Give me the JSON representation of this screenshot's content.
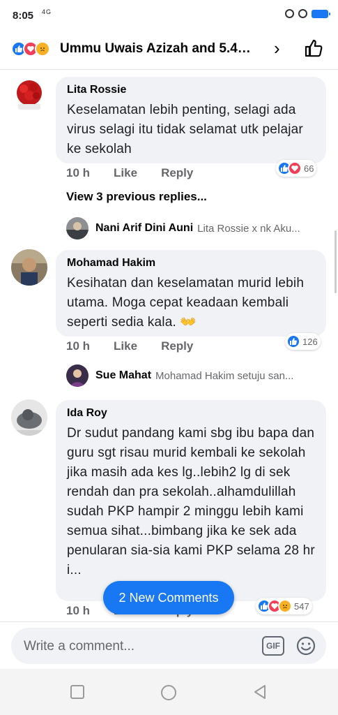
{
  "status": {
    "time": "8:05",
    "network": "4G"
  },
  "header": {
    "title": "Ummu Uwais Azizah and 5.4…",
    "chevron": "›"
  },
  "comments": [
    {
      "name": "Lita Rossie",
      "text": "Keselamatan lebih penting, selagi ada virus selagi itu tidak selamat utk pelajar ke sekolah",
      "time": "10 h",
      "like_label": "Like",
      "reply_label": "Reply",
      "reactions": [
        "like",
        "love"
      ],
      "reaction_count": "66",
      "view_previous": "View 3 previous replies...",
      "latest_reply": {
        "name": "Nani Arif Dini Auni",
        "text": "Lita Rossie x nk Aku..."
      }
    },
    {
      "name": "Mohamad Hakim",
      "text": "Kesihatan dan keselamatan murid lebih utama. Moga cepat keadaan kembali seperti sedia kala. 👐",
      "time": "10 h",
      "like_label": "Like",
      "reply_label": "Reply",
      "reactions": [
        "like"
      ],
      "reaction_count": "126",
      "latest_reply": {
        "name": "Sue Mahat",
        "text": "Mohamad Hakim setuju san..."
      }
    },
    {
      "name": "Ida Roy",
      "text": "Dr sudut pandang kami sbg ibu bapa dan guru sgt risau murid kembali ke sekolah jika masih ada kes lg..lebih2 lg di sek rendah dan pra sekolah..alhamdulillah sudah PKP hampir 2 minggu lebih kami semua sihat...bimbang jika ke sek ada penularan sia-sia kami PKP selama 28 hr i...",
      "time": "10 h",
      "like_label": "Like",
      "reply_label": "Reply",
      "reactions": [
        "like",
        "love",
        "sad"
      ],
      "reaction_count": "547"
    }
  ],
  "new_comments_label": "2 New Comments",
  "composer": {
    "placeholder": "Write a comment...",
    "gif_label": "GIF"
  },
  "colors": {
    "accent": "#1877f2",
    "love": "#f33e58",
    "sad": "#f7b125",
    "bubble": "#f0f2f5"
  }
}
